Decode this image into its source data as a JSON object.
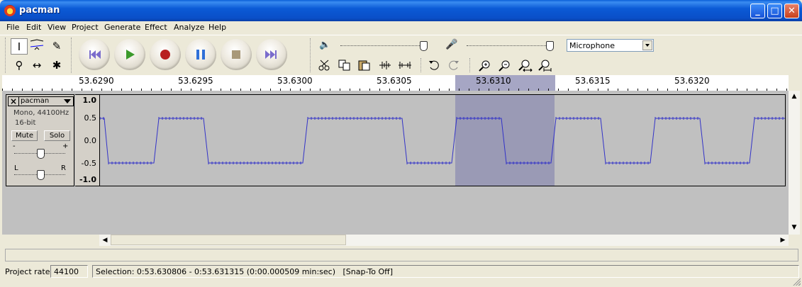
{
  "window": {
    "title": "pacman"
  },
  "menu": [
    {
      "label": "File"
    },
    {
      "label": "Edit"
    },
    {
      "label": "View"
    },
    {
      "label": "Project"
    },
    {
      "label": "Generate"
    },
    {
      "label": "Effect"
    },
    {
      "label": "Analyze"
    },
    {
      "label": "Help"
    }
  ],
  "toolbar": {
    "tools": [
      "selection-tool",
      "envelope-tool",
      "draw-tool",
      "zoom-tool",
      "timeshift-tool",
      "multi-tool"
    ],
    "transport": [
      "skip-start",
      "play",
      "record",
      "pause",
      "stop",
      "skip-end"
    ],
    "input_source": "Microphone"
  },
  "ruler": {
    "labels": [
      "53.6290",
      "53.6295",
      "53.6300",
      "53.6305",
      "53.6310",
      "53.6315",
      "53.6320"
    ]
  },
  "track": {
    "name": "pacman",
    "format": "Mono, 44100Hz",
    "bits": "16-bit",
    "mute_label": "Mute",
    "solo_label": "Solo",
    "gain_minus": "-",
    "gain_plus": "+",
    "pan_left": "L",
    "pan_right": "R",
    "vruler": [
      "1.0",
      "0.5",
      "0.0",
      "-0.5",
      "-1.0"
    ]
  },
  "status": {
    "rate_label": "Project rate:",
    "rate_value": "44100",
    "selection_text": "Selection: 0:53.630806 - 0:53.631315 (0:00.000509 min:sec)   [Snap-To Off]"
  },
  "colors": {
    "waveform": "#3232c8",
    "selection": "#9a9ab5",
    "titlebar": "#0a5fd8"
  }
}
